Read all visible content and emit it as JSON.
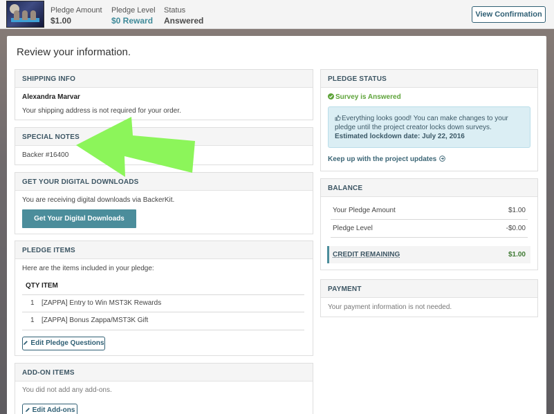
{
  "topbar": {
    "pledge_amount_label": "Pledge Amount",
    "pledge_amount_value": "$1.00",
    "pledge_level_label": "Pledge Level",
    "pledge_level_value": "$0 Reward",
    "status_label": "Status",
    "status_value": "Answered",
    "view_button": "View Confirmation"
  },
  "page_title": "Review your information.",
  "shipping": {
    "heading": "SHIPPING INFO",
    "name": "Alexandra Marvar",
    "note": "Your shipping address is not required for your order."
  },
  "special_notes": {
    "heading": "SPECIAL NOTES",
    "text": "Backer #16400"
  },
  "downloads": {
    "heading": "GET YOUR DIGITAL DOWNLOADS",
    "text": "You are receiving digital downloads via BackerKit.",
    "button": "Get Your Digital Downloads"
  },
  "pledge_items": {
    "heading": "PLEDGE ITEMS",
    "intro": "Here are the items included in your pledge:",
    "col_qty": "QTY",
    "col_item": "ITEM",
    "rows": [
      {
        "qty": "1",
        "item": "[ZAPPA] Entry to Win MST3K Rewards"
      },
      {
        "qty": "1",
        "item": "[ZAPPA] Bonus Zappa/MST3K Gift"
      }
    ],
    "edit_button": "Edit Pledge Questions"
  },
  "addons": {
    "heading": "ADD-ON ITEMS",
    "text": "You did not add any add-ons.",
    "edit_button": "Edit Add-ons"
  },
  "pledge_status": {
    "heading": "PLEDGE STATUS",
    "status": "Survey is Answered",
    "info_line1": "Everything looks good! You can make changes to your",
    "info_line2": "pledge until the project creator locks down surveys.",
    "lockdown": "Estimated lockdown date: July 22, 2016",
    "updates_link": "Keep up with the project updates"
  },
  "balance": {
    "heading": "BALANCE",
    "rows": [
      {
        "label": "Your Pledge Amount",
        "value": "$1.00"
      },
      {
        "label": "Pledge Level",
        "value": "-$0.00"
      }
    ],
    "credit_label": "CREDIT REMAINING",
    "credit_value": "$1.00"
  },
  "payment": {
    "heading": "PAYMENT",
    "text": "Your payment information is not needed."
  },
  "colors": {
    "accent": "#4b8d9b",
    "success": "#5da339",
    "arrow": "#8cf55a"
  }
}
